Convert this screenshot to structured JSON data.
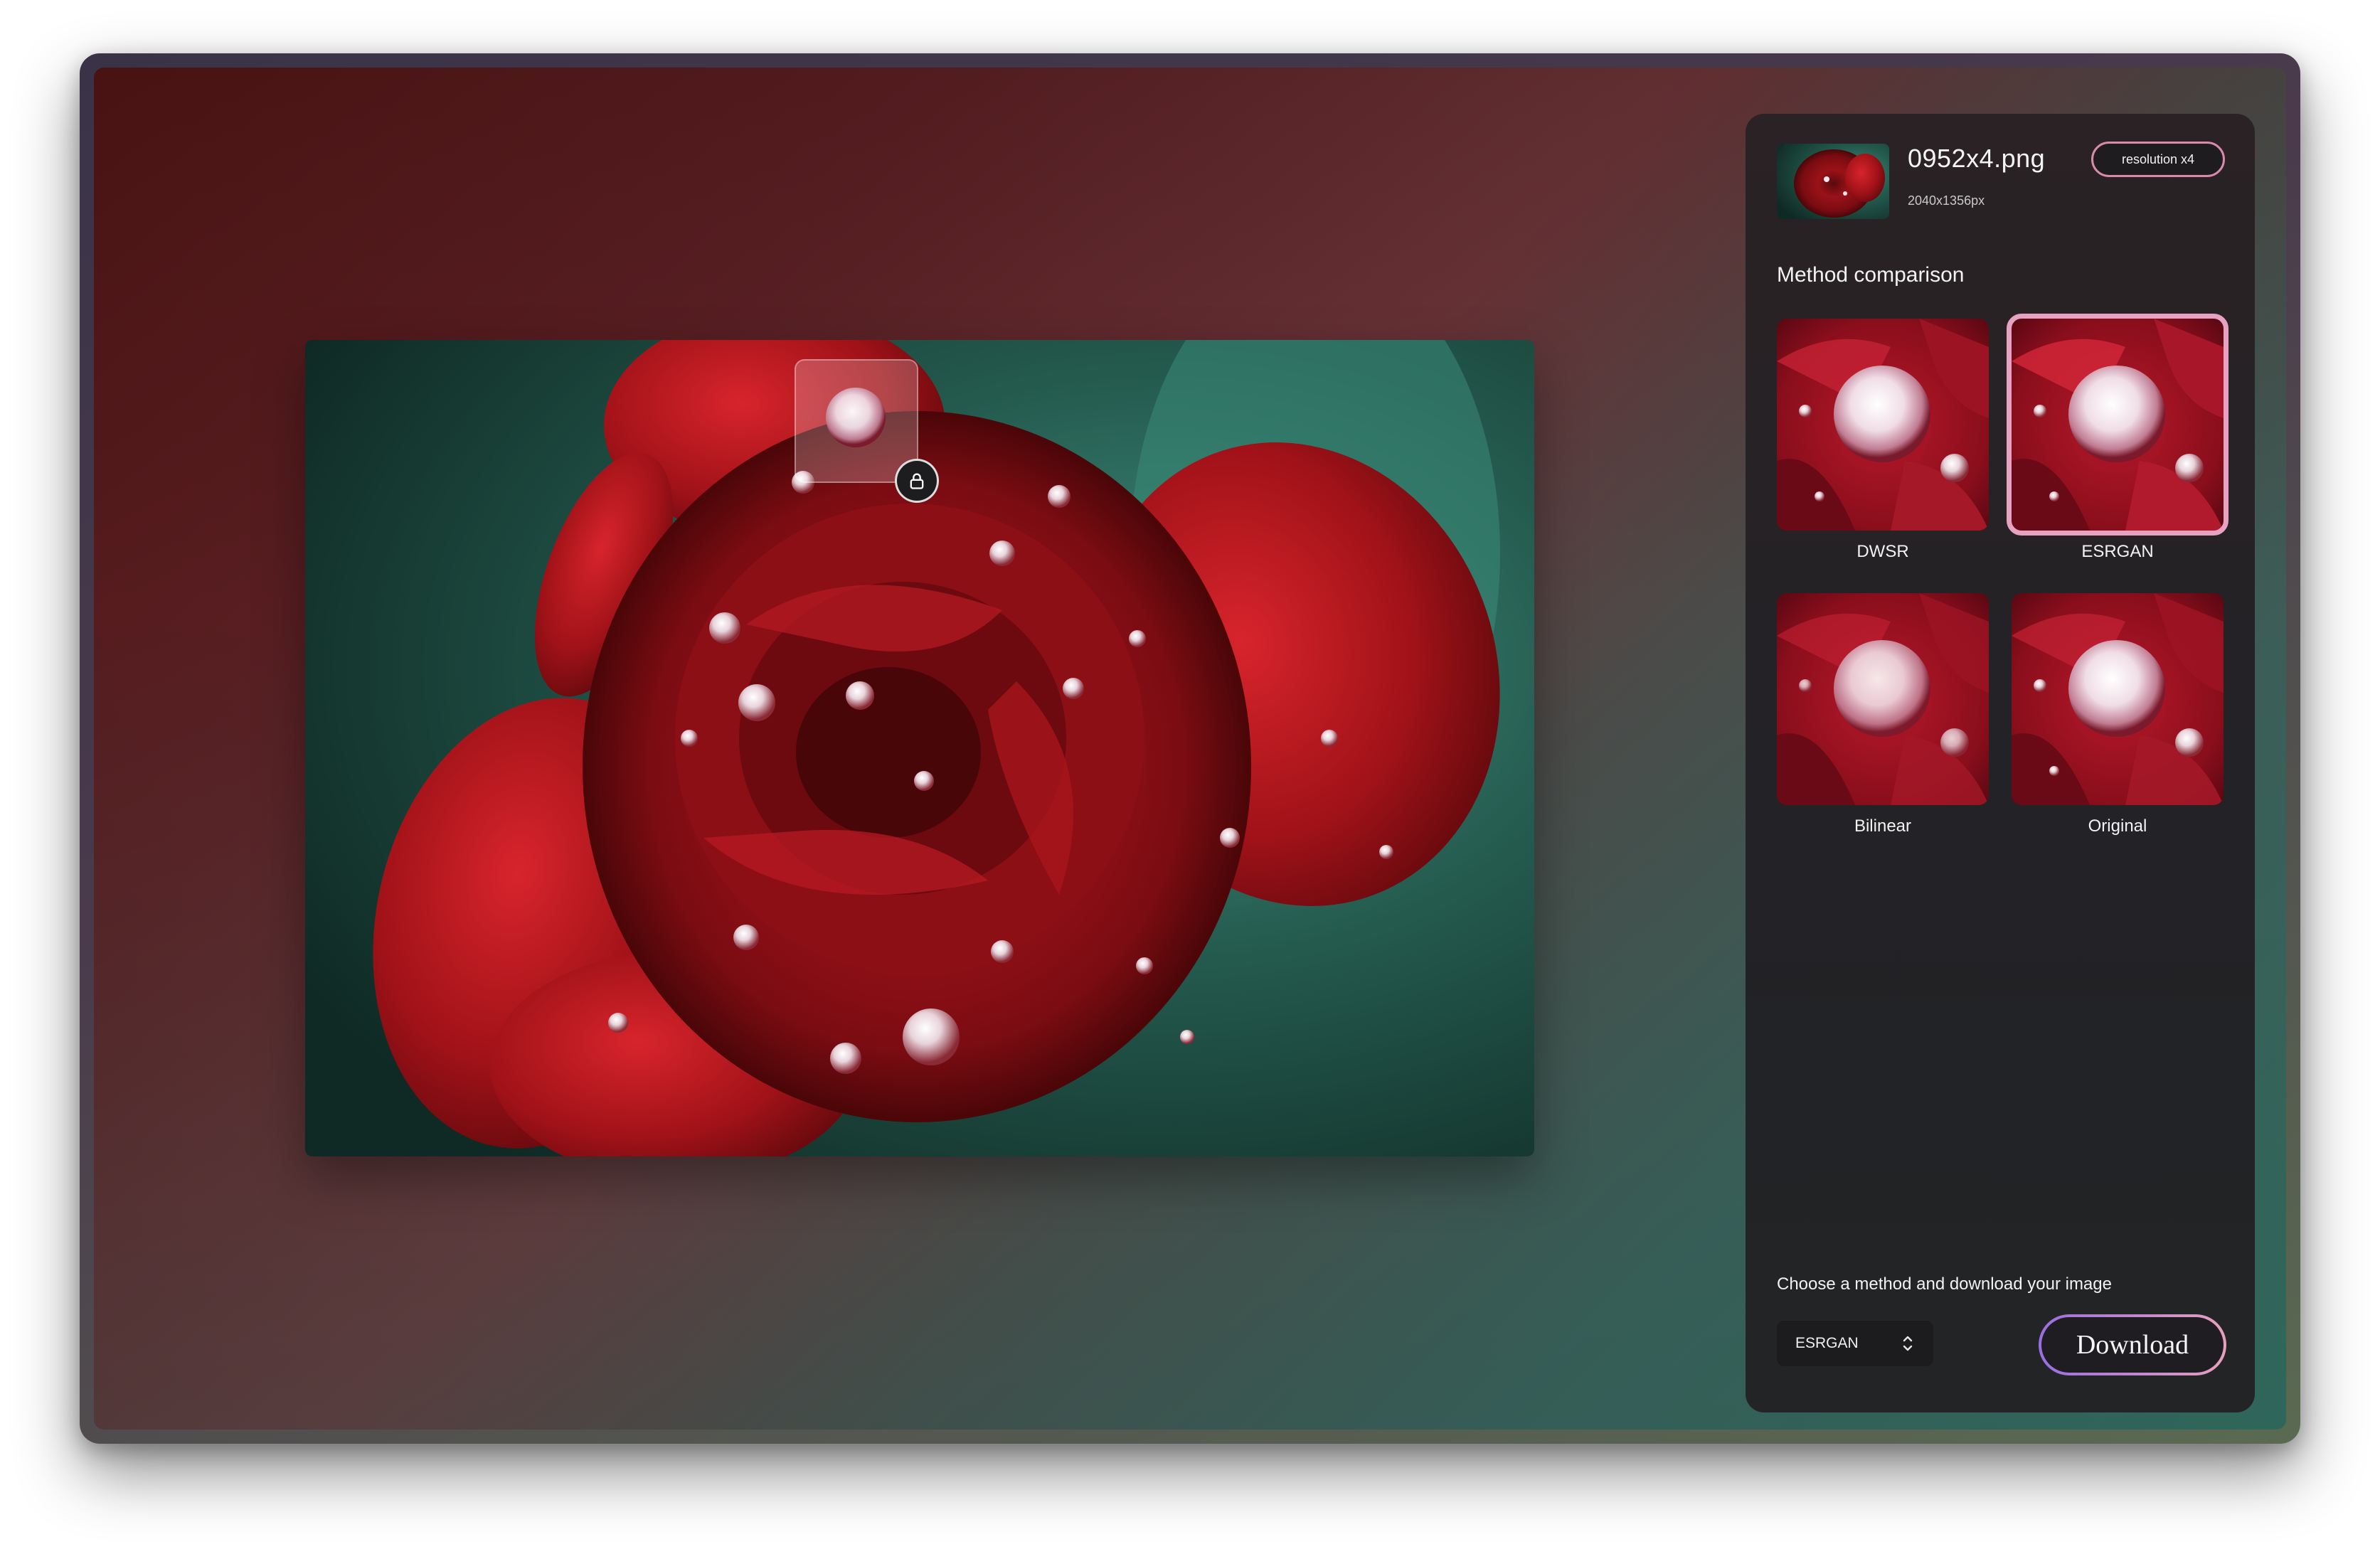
{
  "file": {
    "name": "0952x4.png",
    "dimensions": "2040x1356px",
    "badge": "resolution x4"
  },
  "comparison": {
    "title": "Method comparison",
    "methods": [
      {
        "label": "DWSR",
        "selected": false
      },
      {
        "label": "ESRGAN",
        "selected": true
      },
      {
        "label": "Bilinear",
        "selected": false
      },
      {
        "label": "Original",
        "selected": false
      }
    ]
  },
  "footer": {
    "instruction": "Choose a method and download your image",
    "selected_method": "ESRGAN",
    "download_label": "Download"
  },
  "icons": {
    "lock": "lock-icon",
    "select_chevrons": "chevron-up-down-icon"
  },
  "colors": {
    "accent_pink": "#e7a2c2",
    "accent_purple": "#9a6ee0",
    "panel_bg": "#232226"
  }
}
